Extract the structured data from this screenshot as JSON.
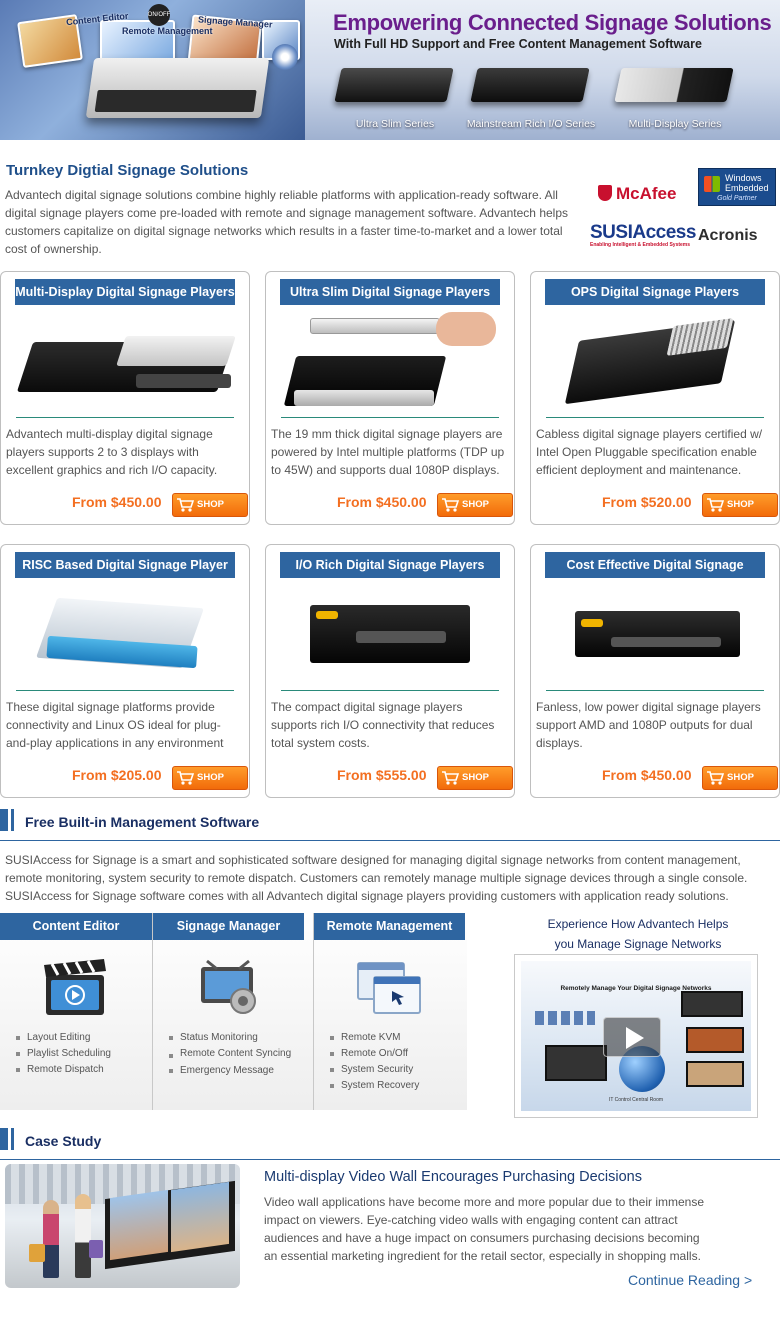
{
  "banner": {
    "title": "Empowering Connected Signage Solutions",
    "subtitle": "With Full HD Support and Free Content Management Software",
    "collage_labels": [
      "Content Editor",
      "Remote Management",
      "Signage Manager"
    ],
    "badge": "ON/OFF",
    "series": [
      {
        "label": "Ultra Slim Series"
      },
      {
        "label": "Mainstream Rich I/O Series"
      },
      {
        "label": "Multi-Display Series"
      }
    ]
  },
  "intro": {
    "title": "Turnkey Digtial Signage Solutions",
    "text": "Advantech digital signage solutions combine highly reliable platforms with application-ready software. All digital signage players come pre-loaded with remote and signage management software. Advantech helps customers capitalize on digital signage networks which results in a faster time-to-market and a lower total cost of ownership.",
    "logos": {
      "mcafee": "McAfee",
      "windows_line1": "Windows",
      "windows_line2": "Embedded",
      "windows_line3": "Gold Partner",
      "susi": "SUSIAccess",
      "susi_sub": "Enabling Intelligent & Embedded Systems",
      "acronis": "Acronis"
    }
  },
  "products": [
    {
      "title": "Multi-Display Digital Signage Players",
      "desc": "Advantech multi-display digital signage players supports 2 to 3 displays with excellent graphics and rich I/O capacity.",
      "price": "From $450.00",
      "shop": "SHOP NOW"
    },
    {
      "title": "Ultra Slim Digital Signage Players",
      "desc": "The 19 mm thick digital signage players are powered by Intel multiple platforms (TDP up to 45W) and supports dual 1080P displays.",
      "price": "From $450.00",
      "shop": "SHOP NOW"
    },
    {
      "title": "OPS Digital Signage Players",
      "desc": "Cabless digital signage players certified w/ Intel Open Pluggable specification enable efficient deployment and maintenance.",
      "price": "From $520.00",
      "shop": "SHOP NOW"
    },
    {
      "title": "RISC Based Digital Signage Player",
      "desc": "These digital signage platforms provide connectivity and Linux OS ideal for plug-and-play applications in any environment",
      "price": "From $205.00",
      "shop": "SHOP NOW"
    },
    {
      "title": "I/O Rich Digital Signage Players",
      "desc": "The compact digital signage players supports rich I/O connectivity that reduces total system costs.",
      "price": "From $555.00",
      "shop": "SHOP NOW"
    },
    {
      "title": "Cost Effective Digital Signage Players",
      "desc": "Fanless, low power digital signage players support AMD and 1080P outputs for dual displays.",
      "price": "From $450.00",
      "shop": "SHOP NOW"
    }
  ],
  "management": {
    "heading": "Free Built-in Management Software",
    "text": "SUSIAccess for Signage is a smart and sophisticated software designed for managing digital signage networks from content management, remote monitoring, system security to remote dispatch. Customers can remotely manage multiple signage devices through a single console. SUSIAccess for Signage software comes with all Advantech digital signage players providing customers with application ready solutions.",
    "columns": [
      {
        "title": "Content Editor",
        "icon": "clapperboard-icon",
        "items": [
          "Layout Editing",
          "Playlist Scheduling",
          "Remote Dispatch"
        ]
      },
      {
        "title": "Signage Manager",
        "icon": "monitor-gear-icon",
        "items": [
          "Status Monitoring",
          "Remote Content Syncing",
          "Emergency Message"
        ]
      },
      {
        "title": "Remote Management",
        "icon": "remote-window-icon",
        "items": [
          "Remote KVM",
          "Remote On/Off",
          "System Security",
          "System Recovery"
        ]
      }
    ],
    "experience_line1": "Experience How Advantech Helps",
    "experience_line2": "you Manage Signage Networks",
    "video_title": "Remotely Manage Your Digital Signage Networks",
    "video_footer": "IT Control Central Room"
  },
  "case_study": {
    "heading": "Case Study",
    "title": "Multi-display Video Wall Encourages Purchasing Decisions",
    "text": "Video wall applications have become more and more popular due to their immense impact on viewers. Eye-catching video walls with engaging content can attract audiences and have a huge impact on consumers purchasing decisions becoming an essential marketing ingredient for the retail sector, especially in shopping malls.",
    "link": "Continue Reading >"
  },
  "colors": {
    "brand_blue": "#2e65a0",
    "price_orange": "#f36f21",
    "title_purple": "#6a1e8c"
  }
}
